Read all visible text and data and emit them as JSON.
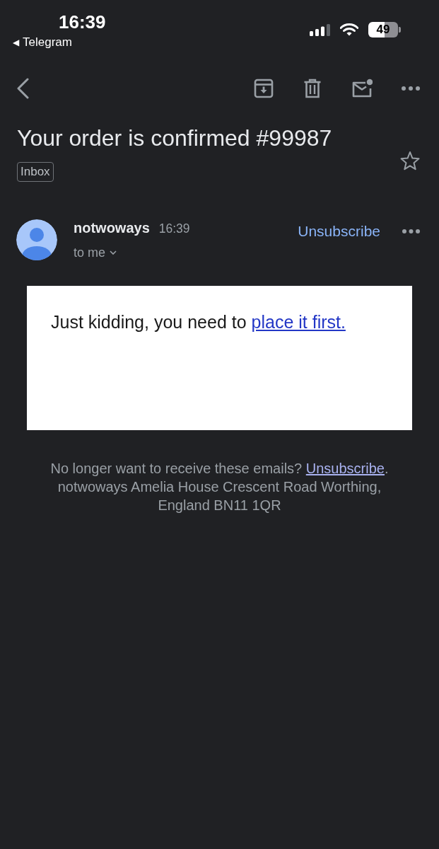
{
  "status_bar": {
    "time": "16:39",
    "back_arrow": "◀",
    "back_app": "Telegram",
    "battery": "49"
  },
  "email": {
    "subject": "Your order is confirmed #99987",
    "labels": [
      "Inbox"
    ],
    "starred": false,
    "sender": {
      "name": "notwoways",
      "time": "16:39",
      "recipient": "to me",
      "unsubscribe": "Unsubscribe"
    },
    "body": {
      "text": "Just kidding, you need to",
      "link": "place it first."
    },
    "footer": {
      "text": "No longer want to receive these emails?",
      "link": "Unsubscribe",
      "text_after": ".",
      "address": "notwoways Amelia House Crescent Road Worthing, England BN11 1QR"
    }
  }
}
